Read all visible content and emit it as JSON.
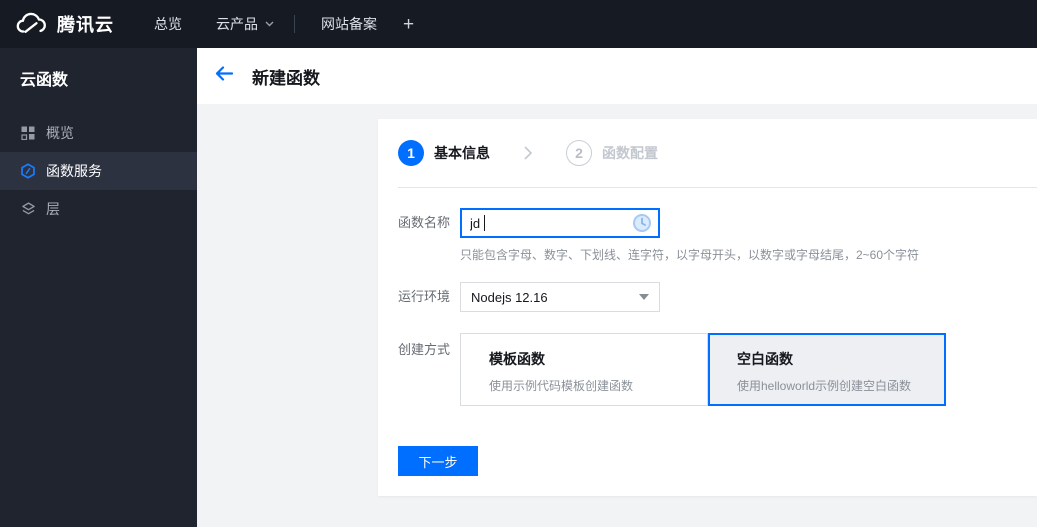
{
  "topbar": {
    "brand": "腾讯云",
    "nav": [
      {
        "label": "总览"
      },
      {
        "label": "云产品"
      }
    ],
    "tab": "网站备案",
    "add_tab": "+"
  },
  "sidebar": {
    "title": "云函数",
    "items": [
      {
        "label": "概览",
        "icon": "grid-icon",
        "active": false
      },
      {
        "label": "函数服务",
        "icon": "function-hexagon-icon",
        "active": true
      },
      {
        "label": "层",
        "icon": "layers-icon",
        "active": false
      }
    ]
  },
  "header": {
    "title": "新建函数",
    "back_icon": "back-arrow-icon"
  },
  "wizard": {
    "steps": [
      {
        "num": "1",
        "label": "基本信息",
        "state": "current"
      },
      {
        "num": "2",
        "label": "函数配置",
        "state": "upcoming"
      }
    ]
  },
  "form": {
    "function_name": {
      "label": "函数名称",
      "value": "jd",
      "status_icon": "clock-icon",
      "help": "只能包含字母、数字、下划线、连字符，以字母开头，以数字或字母结尾，2~60个字符"
    },
    "runtime": {
      "label": "运行环境",
      "value": "Nodejs 12.16",
      "arrow_icon": "chevron-down-icon"
    },
    "create_method": {
      "label": "创建方式",
      "options": [
        {
          "title": "模板函数",
          "desc": "使用示例代码模板创建函数",
          "selected": false
        },
        {
          "title": "空白函数",
          "desc": "使用helloworld示例创建空白函数",
          "selected": true
        }
      ]
    }
  },
  "actions": {
    "next": "下一步"
  },
  "colors": {
    "accent": "#006eff",
    "topbar_bg": "#161a23",
    "sidebar_bg": "#20242e",
    "sidebar_active_bg": "#2c3240",
    "content_bg": "#f2f3f5",
    "selected_card_bg": "#edeff2"
  }
}
